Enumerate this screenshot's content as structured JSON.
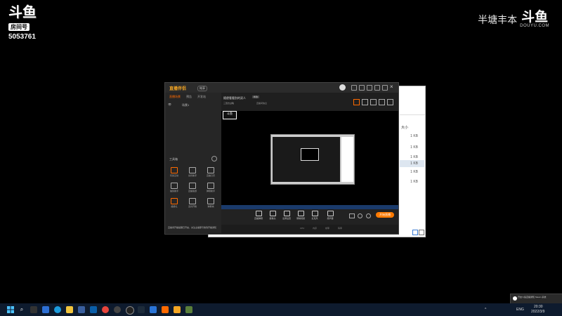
{
  "overlay": {
    "room_label": "房间号",
    "room_number": "5053761",
    "logo_glyph": "斗鱼",
    "streamer_text": "半塘丰本",
    "site_url": "DOUYU.COM"
  },
  "app": {
    "logo_text": "直播伴侣",
    "version_badge": "纯享",
    "sidebar_tabs": [
      "直播场景",
      "预告",
      "开发站"
    ],
    "scene_label": "场景1",
    "toolbox_heading": "工具箱",
    "tools": [
      {
        "label": "有奖互动",
        "highlight": true
      },
      {
        "label": "房管助手",
        "highlight": false
      },
      {
        "label": "直播日历",
        "highlight": false
      },
      {
        "label": "抽奖助手",
        "highlight": false
      },
      {
        "label": "直播答题",
        "highlight": false
      },
      {
        "label": "弹幕助手",
        "highlight": false
      },
      {
        "label": "超级礼",
        "highlight": true
      },
      {
        "label": "道具开箱",
        "highlight": false
      },
      {
        "label": "弹幕墙",
        "highlight": false
      }
    ],
    "room_title": "随便看看别的双人",
    "room_title_tag": "修改",
    "category": "三国志战略",
    "sub_info": "直播间信息",
    "controls": [
      {
        "label": "直播弹幕"
      },
      {
        "label": "摄像头"
      },
      {
        "label": "全屏设置"
      },
      {
        "label": "录制视频"
      },
      {
        "label": "麦克风"
      },
      {
        "label": "扬声器"
      }
    ],
    "start_button": "开始直播",
    "ticker_text": "直播间开播提醒已开启，关注主播即可收到开播通知",
    "status_items": [
      "CPU",
      "内存",
      "帧率",
      "码率"
    ]
  },
  "bg_window": {
    "column_header": "大小",
    "values": [
      "1 KB",
      "1 KB",
      "1 KB",
      "1 KB",
      "1 KB",
      "1 KB"
    ]
  },
  "notification": {
    "text": "开启斗鱼直播通知 Steam 系统"
  },
  "taskbar": {
    "lang": "ENG",
    "time": "20:30",
    "date": "2022/3/9"
  },
  "colors": {
    "accent": "#ff7a00",
    "taskbar": "#0e1b2e"
  }
}
